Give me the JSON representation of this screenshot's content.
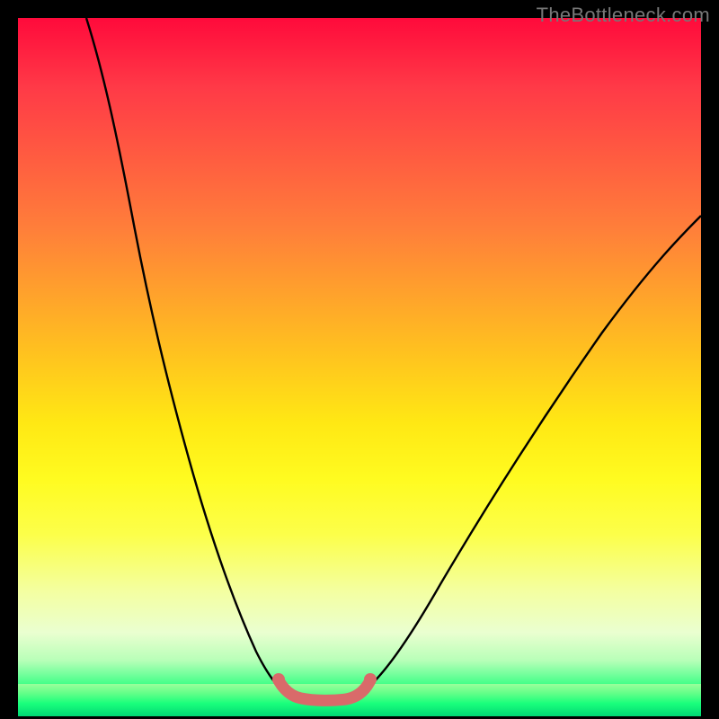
{
  "watermark": "TheBottleneck.com",
  "chart_data": {
    "type": "line",
    "title": "",
    "xlabel": "",
    "ylabel": "",
    "xlim": [
      0,
      100
    ],
    "ylim": [
      0,
      100
    ],
    "series": [
      {
        "name": "left-curve",
        "x": [
          10,
          14,
          18,
          22,
          26,
          30,
          33,
          35,
          37,
          39
        ],
        "y": [
          100,
          82,
          65,
          50,
          36,
          22,
          12,
          7,
          4,
          3
        ]
      },
      {
        "name": "valley",
        "x": [
          39,
          41,
          43,
          45,
          47,
          49
        ],
        "y": [
          3,
          2.5,
          2.5,
          2.5,
          2.5,
          3
        ]
      },
      {
        "name": "right-curve",
        "x": [
          49,
          52,
          56,
          62,
          70,
          80,
          90,
          100
        ],
        "y": [
          3,
          5,
          10,
          19,
          33,
          49,
          62,
          72
        ]
      }
    ],
    "highlight": {
      "name": "bottleneck-range",
      "x": [
        38,
        40,
        42,
        44,
        46,
        48,
        50
      ],
      "y": [
        4.5,
        3,
        2.5,
        2.5,
        2.5,
        3,
        4.5
      ]
    },
    "background_gradient": {
      "top": "#ff0a3b",
      "mid": "#ffe814",
      "bottom": "#00e57a"
    }
  }
}
